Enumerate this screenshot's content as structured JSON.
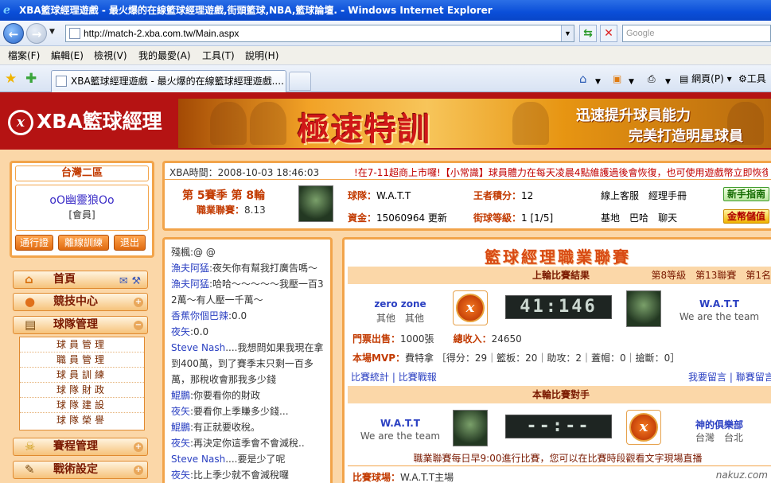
{
  "browser": {
    "title": "XBA籃球經理遊戲 - 最火爆的在線籃球經理遊戲,街頭籃球,NBA,籃球論壇. - Windows Internet Explorer",
    "url": "http://match-2.xba.com.tw/Main.aspx",
    "search_placeholder": "Google",
    "menu": [
      "檔案(F)",
      "編輯(E)",
      "檢視(V)",
      "我的最愛(A)",
      "工具(T)",
      "說明(H)"
    ],
    "tab_title": "XBA籃球經理遊戲 - 最火爆的在線籃球經理遊戲....",
    "toolbar_page": "網頁(P)",
    "toolbar_tools": "工具"
  },
  "header": {
    "logo_text": "XBA籃球經理",
    "banner_main": "極速特訓",
    "banner_sub1": "迅速提升球員能力",
    "banner_sub2": "完美打造明星球員"
  },
  "user": {
    "server": "台灣二區",
    "name": "oO幽靈狼Oo",
    "role": "[會員]",
    "buttons": [
      "通行證",
      "離線訓練",
      "退出"
    ]
  },
  "nav": {
    "home": "首頁",
    "competition": "競技中心",
    "team_manage": "球隊管理",
    "team_sub": [
      "球員管理",
      "職員管理",
      "球員訓練",
      "球隊財政",
      "球隊建設",
      "球隊榮譽"
    ],
    "schedule": "賽程管理",
    "tactics": "戰術設定"
  },
  "info": {
    "time": "XBA時間：2008-10-03 18:46:03",
    "marquee": "!在7-11超商上市囉!【小常識】球員體力在每天凌晨4點維護過後會恢復，也可使用遊戲幣立即恢復",
    "season": "第 5賽季 第 8輪",
    "league_score_label": "職業聯賽：",
    "league_score": "8.13",
    "team_label": "球隊：",
    "team": "W.A.T.T",
    "king_label": "王者積分：",
    "king": "12",
    "online_service": "線上客服",
    "manager_manual": "經理手冊",
    "funds_label": "資金：",
    "funds": "15060964",
    "update": "更新",
    "street_label": "街球等級：",
    "street": "1 [1/5]",
    "base": "基地",
    "baha": "巴哈",
    "chat": "聊天",
    "guide_btn": "新手指南",
    "gold_btn": "金幣儲值"
  },
  "chat": [
    {
      "who": "",
      "text": "殘楓:@ @"
    },
    {
      "who": "漁夫阿猛",
      "text": ":夜矢你有幫我打廣告嗎～"
    },
    {
      "who": "漁夫阿猛",
      "text": ":哈哈～～～～～我壓一百32萬～有人壓一千萬～"
    },
    {
      "who": "香蕉你個巴辣",
      "text": ":0.0"
    },
    {
      "who": "夜矢",
      "text": ":0.0"
    },
    {
      "who": "Steve Nash",
      "text": "....我想問如果我現在拿到400萬，到了賽季末只剩一百多萬，那稅收會那我多少錢"
    },
    {
      "who": "鯤鵬",
      "text": ":你要看你的財政"
    },
    {
      "who": "夜矢",
      "text": ":要看你上季賺多少錢..."
    },
    {
      "who": "鯤鵬",
      "text": ":有正就要收稅。"
    },
    {
      "who": "夜矢",
      "text": ":再決定你這季會不會減稅.."
    },
    {
      "who": "Steve Nash",
      "text": "....要是少了呢"
    },
    {
      "who": "夜矢",
      "text": ":比上季少就不會減稅囉"
    }
  ],
  "league": {
    "title": "籃球經理職業聯賽",
    "last_header": "上輪比賽結果",
    "last_level": "第8等級　第13聯賽　第1名",
    "home_team": "zero zone",
    "home_loc": "其他　其他",
    "score": "41:146",
    "away_team": "W.A.T.T",
    "away_motto": "We are the team",
    "tickets_label": "門票出售：",
    "tickets": "1000張",
    "income_label": "總收入：",
    "income": "24650",
    "mvp_label": "本場MVP：",
    "mvp": "費特拿 ［得分：29｜籃板：20｜助攻：2｜蓋帽：0｜搶斷：0］",
    "link_stats": "比賽統計",
    "link_report": "比賽戰報",
    "link_comment": "我要留言",
    "link_league_comment": "聯賽留言",
    "next_header": "本輪比賽對手",
    "next_home": "W.A.T.T",
    "next_home_motto": "We are the team",
    "next_score": "--:--",
    "next_away": "神的俱樂部",
    "next_away_loc": "台灣　台北",
    "notice": "職業聯賽每日早9:00進行比賽，您可以在比賽時段觀看文字現場直播",
    "venue_label": "比賽球場：",
    "venue": "W.A.T.T主場"
  },
  "watermark": "nakuz.com"
}
